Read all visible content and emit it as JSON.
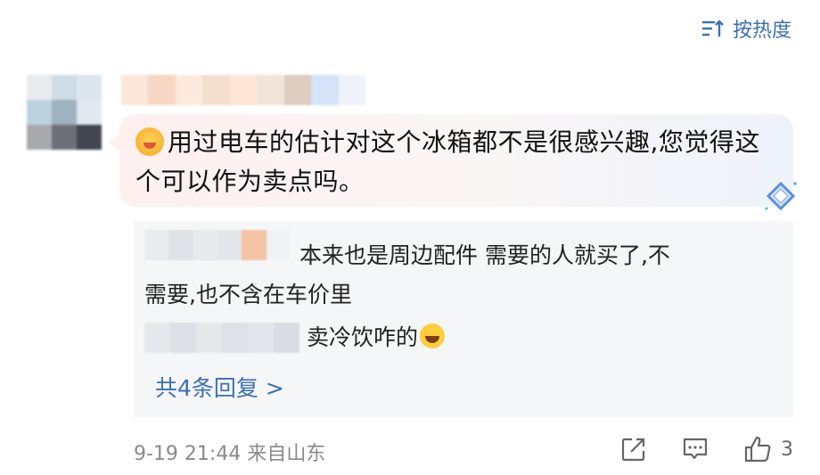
{
  "sort": {
    "label": "按热度"
  },
  "comment": {
    "text": "用过电车的估计对这个冰箱都不是很感兴趣,您觉得这个可以作为卖点吗。",
    "emoji": "yummy-face-emoji"
  },
  "replies": [
    {
      "text_line1": "本来也是周边配件 需要的人就买了,不",
      "text_line2": "需要,也不含在车价里"
    },
    {
      "text": "卖冷饮咋的",
      "emoji": "laughing-emoji"
    }
  ],
  "more_replies": "共4条回复 >",
  "meta": {
    "time": "9-19 21:44",
    "location": "来自山东"
  },
  "actions": {
    "share_icon": "share-icon",
    "reply_icon": "comment-icon",
    "like_icon": "thumbs-up-icon",
    "like_count": "3"
  },
  "colors": {
    "link": "#3c6fb4",
    "reply_bg": "#f5f6f8",
    "meta": "#8a8a8a"
  }
}
